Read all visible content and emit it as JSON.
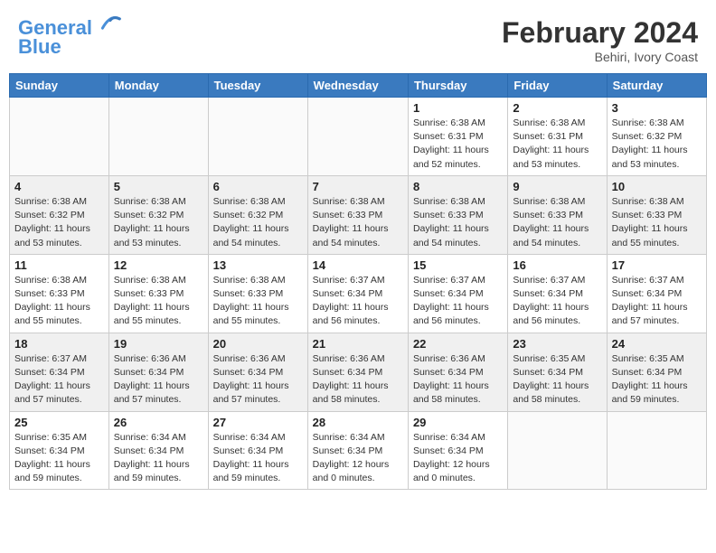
{
  "header": {
    "logo_line1": "General",
    "logo_line2": "Blue",
    "month_year": "February 2024",
    "location": "Behiri, Ivory Coast"
  },
  "weekdays": [
    "Sunday",
    "Monday",
    "Tuesday",
    "Wednesday",
    "Thursday",
    "Friday",
    "Saturday"
  ],
  "weeks": [
    [
      {
        "day": "",
        "info": ""
      },
      {
        "day": "",
        "info": ""
      },
      {
        "day": "",
        "info": ""
      },
      {
        "day": "",
        "info": ""
      },
      {
        "day": "1",
        "info": "Sunrise: 6:38 AM\nSunset: 6:31 PM\nDaylight: 11 hours\nand 52 minutes."
      },
      {
        "day": "2",
        "info": "Sunrise: 6:38 AM\nSunset: 6:31 PM\nDaylight: 11 hours\nand 53 minutes."
      },
      {
        "day": "3",
        "info": "Sunrise: 6:38 AM\nSunset: 6:32 PM\nDaylight: 11 hours\nand 53 minutes."
      }
    ],
    [
      {
        "day": "4",
        "info": "Sunrise: 6:38 AM\nSunset: 6:32 PM\nDaylight: 11 hours\nand 53 minutes."
      },
      {
        "day": "5",
        "info": "Sunrise: 6:38 AM\nSunset: 6:32 PM\nDaylight: 11 hours\nand 53 minutes."
      },
      {
        "day": "6",
        "info": "Sunrise: 6:38 AM\nSunset: 6:32 PM\nDaylight: 11 hours\nand 54 minutes."
      },
      {
        "day": "7",
        "info": "Sunrise: 6:38 AM\nSunset: 6:33 PM\nDaylight: 11 hours\nand 54 minutes."
      },
      {
        "day": "8",
        "info": "Sunrise: 6:38 AM\nSunset: 6:33 PM\nDaylight: 11 hours\nand 54 minutes."
      },
      {
        "day": "9",
        "info": "Sunrise: 6:38 AM\nSunset: 6:33 PM\nDaylight: 11 hours\nand 54 minutes."
      },
      {
        "day": "10",
        "info": "Sunrise: 6:38 AM\nSunset: 6:33 PM\nDaylight: 11 hours\nand 55 minutes."
      }
    ],
    [
      {
        "day": "11",
        "info": "Sunrise: 6:38 AM\nSunset: 6:33 PM\nDaylight: 11 hours\nand 55 minutes."
      },
      {
        "day": "12",
        "info": "Sunrise: 6:38 AM\nSunset: 6:33 PM\nDaylight: 11 hours\nand 55 minutes."
      },
      {
        "day": "13",
        "info": "Sunrise: 6:38 AM\nSunset: 6:33 PM\nDaylight: 11 hours\nand 55 minutes."
      },
      {
        "day": "14",
        "info": "Sunrise: 6:37 AM\nSunset: 6:34 PM\nDaylight: 11 hours\nand 56 minutes."
      },
      {
        "day": "15",
        "info": "Sunrise: 6:37 AM\nSunset: 6:34 PM\nDaylight: 11 hours\nand 56 minutes."
      },
      {
        "day": "16",
        "info": "Sunrise: 6:37 AM\nSunset: 6:34 PM\nDaylight: 11 hours\nand 56 minutes."
      },
      {
        "day": "17",
        "info": "Sunrise: 6:37 AM\nSunset: 6:34 PM\nDaylight: 11 hours\nand 57 minutes."
      }
    ],
    [
      {
        "day": "18",
        "info": "Sunrise: 6:37 AM\nSunset: 6:34 PM\nDaylight: 11 hours\nand 57 minutes."
      },
      {
        "day": "19",
        "info": "Sunrise: 6:36 AM\nSunset: 6:34 PM\nDaylight: 11 hours\nand 57 minutes."
      },
      {
        "day": "20",
        "info": "Sunrise: 6:36 AM\nSunset: 6:34 PM\nDaylight: 11 hours\nand 57 minutes."
      },
      {
        "day": "21",
        "info": "Sunrise: 6:36 AM\nSunset: 6:34 PM\nDaylight: 11 hours\nand 58 minutes."
      },
      {
        "day": "22",
        "info": "Sunrise: 6:36 AM\nSunset: 6:34 PM\nDaylight: 11 hours\nand 58 minutes."
      },
      {
        "day": "23",
        "info": "Sunrise: 6:35 AM\nSunset: 6:34 PM\nDaylight: 11 hours\nand 58 minutes."
      },
      {
        "day": "24",
        "info": "Sunrise: 6:35 AM\nSunset: 6:34 PM\nDaylight: 11 hours\nand 59 minutes."
      }
    ],
    [
      {
        "day": "25",
        "info": "Sunrise: 6:35 AM\nSunset: 6:34 PM\nDaylight: 11 hours\nand 59 minutes."
      },
      {
        "day": "26",
        "info": "Sunrise: 6:34 AM\nSunset: 6:34 PM\nDaylight: 11 hours\nand 59 minutes."
      },
      {
        "day": "27",
        "info": "Sunrise: 6:34 AM\nSunset: 6:34 PM\nDaylight: 11 hours\nand 59 minutes."
      },
      {
        "day": "28",
        "info": "Sunrise: 6:34 AM\nSunset: 6:34 PM\nDaylight: 12 hours\nand 0 minutes."
      },
      {
        "day": "29",
        "info": "Sunrise: 6:34 AM\nSunset: 6:34 PM\nDaylight: 12 hours\nand 0 minutes."
      },
      {
        "day": "",
        "info": ""
      },
      {
        "day": "",
        "info": ""
      }
    ]
  ]
}
